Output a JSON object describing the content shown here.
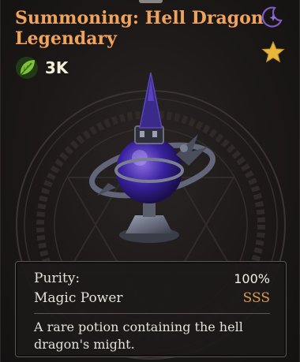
{
  "item": {
    "title_line1": "Summoning: Hell Dragon",
    "title_line2": "Legendary",
    "resource_icon": "leaf-icon",
    "resource_value": "3K",
    "badges": [
      "crescent-moon-icon",
      "star-icon"
    ]
  },
  "stats": {
    "purity_label": "Purity:",
    "purity_value": "100%",
    "power_label": "Magic Power",
    "power_value": "SSS"
  },
  "description": "A rare potion containing the hell dragon's might.",
  "colors": {
    "title": "#f0a35c",
    "accent_purple": "#7d5cc8",
    "star": "#e8b73a",
    "grade": "#d99a55"
  }
}
